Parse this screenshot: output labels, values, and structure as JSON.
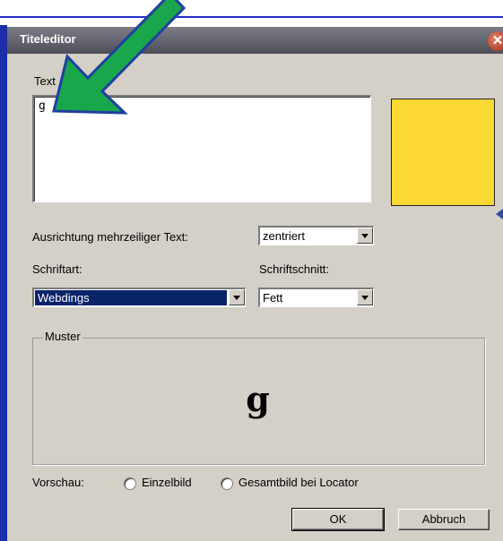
{
  "window": {
    "title": "Titeleditor"
  },
  "text_section": {
    "label": "Text",
    "value": "g"
  },
  "color_preview": {
    "color": "#fcd835"
  },
  "alignment": {
    "label": "Ausrichtung mehrzeiliger Text:",
    "value": "zentriert"
  },
  "font": {
    "label": "Schriftart:",
    "value": "Webdings"
  },
  "style": {
    "label": "Schriftschnitt:",
    "value": "Fett"
  },
  "sample": {
    "label": "Muster",
    "text": "g"
  },
  "preview": {
    "label": "Vorschau:",
    "options": [
      "Einzelbild",
      "Gesamtbild bei Locator"
    ]
  },
  "buttons": {
    "ok": "OK",
    "cancel": "Abbruch"
  },
  "annotation": {
    "arrow_color": "#1aa64a",
    "arrow_outline": "#1f3fa0"
  }
}
